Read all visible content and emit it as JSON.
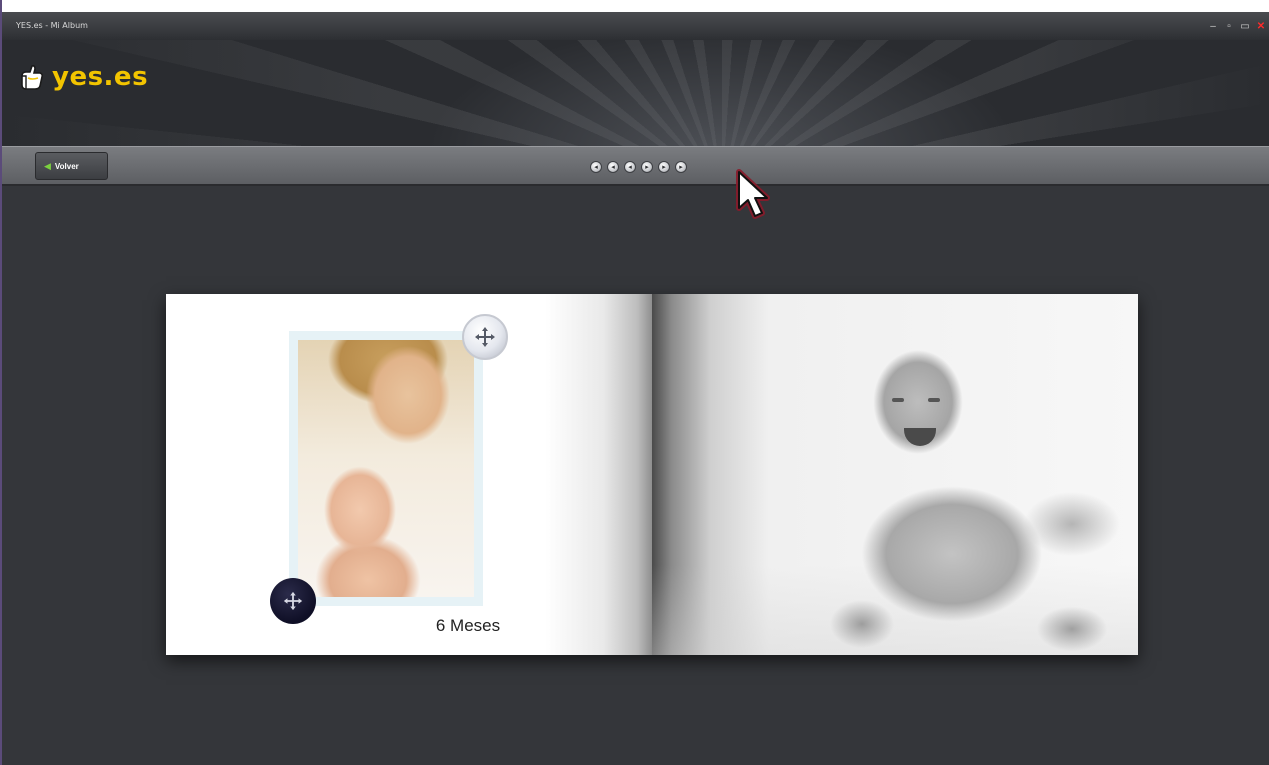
{
  "window": {
    "title": "YES.es - Mi Album",
    "controls": [
      "minimize",
      "maximize",
      "restore",
      "close"
    ],
    "control_glyphs": {
      "minimize": "‒",
      "maximize": "▫",
      "restore": "▭",
      "close": "✕"
    }
  },
  "header": {
    "logo_text": "yes.es",
    "logo_icon": "thumbs-up-icon",
    "logo_color": "#f2c400"
  },
  "toolbar": {
    "back_label": "Volver",
    "back_icon": "arrow-left-icon",
    "page_dots": [
      {
        "glyph": "◂"
      },
      {
        "glyph": "◂"
      },
      {
        "glyph": "◂"
      },
      {
        "glyph": "▸"
      },
      {
        "glyph": "▸"
      },
      {
        "glyph": "▸"
      }
    ]
  },
  "album": {
    "left_page": {
      "caption": "6 Meses",
      "photo_desc_icon": "photo-mother-baby",
      "move_handle_light": "move-icon",
      "move_handle_dark": "move-icon"
    },
    "right_page": {
      "photo_desc_icon": "photo-baby-bw"
    }
  },
  "colors": {
    "background": "#34363a",
    "toolbar": "#6b6d71",
    "accent_green": "#7bd13f",
    "cursor_glow": "#8a1a2a"
  }
}
